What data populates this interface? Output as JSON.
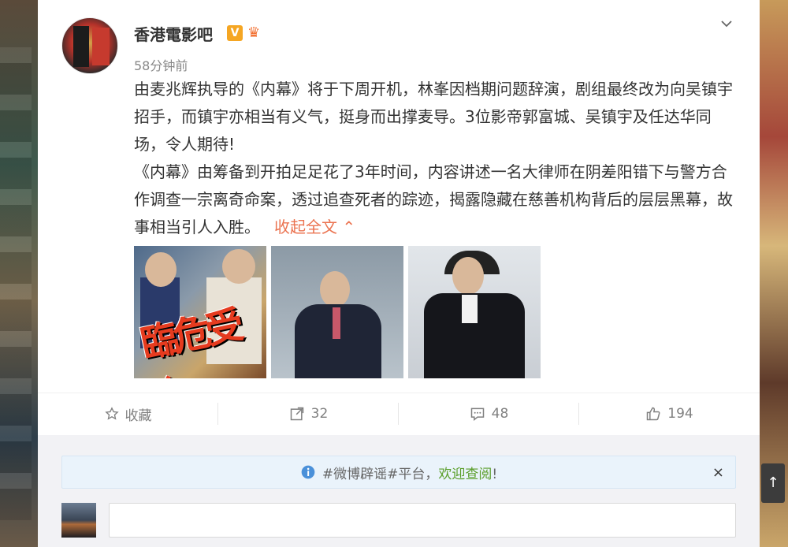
{
  "post": {
    "username": "香港電影吧",
    "verified_badge": "V",
    "time": "58分钟前",
    "paragraphs": [
      "由麦兆辉执导的《内幕》将于下周开机，林峯因档期问题辞演，剧组最终改为向吴镇宇招手，而镇宇亦相当有义气，挺身而出撑麦导。3位影帝郭富城、吴镇宇及任达华同场，令人期待!",
      "《内幕》由筹备到开拍足足花了3年时间，内容讲述一名大律师在阴差阳错下与警方合作调查一宗离奇命案，透过追查死者的踪迹，揭露隐藏在慈善机构背后的层层黑幕，故事相当引人入胜。"
    ],
    "collapse_label": "收起全文",
    "poster_text": "臨危受命"
  },
  "actions": {
    "favorite_label": "收藏",
    "repost_count": "32",
    "comment_count": "48",
    "like_count": "194"
  },
  "notice": {
    "text_prefix": "#微博辟谣#平台，",
    "text_em": "欢迎查阅",
    "text_suffix": "!",
    "close": "×"
  },
  "icons": {
    "menu": "chevron-down-icon",
    "favorite": "star-icon",
    "repost": "share-icon",
    "comment": "comment-icon",
    "like": "thumbs-up-icon",
    "info": "info-icon"
  },
  "colors": {
    "link": "#eb7350",
    "notice_bg": "#eaf3fb",
    "notice_em": "#5a9e2a"
  }
}
